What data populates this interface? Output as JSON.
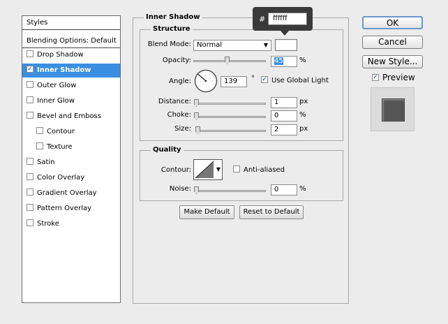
{
  "styles_panel": {
    "header": "Styles",
    "blending_options": "Blending Options: Default",
    "items": [
      {
        "label": "Drop Shadow",
        "checked": false,
        "indent": false
      },
      {
        "label": "Inner Shadow",
        "checked": true,
        "indent": false,
        "selected": true
      },
      {
        "label": "Outer Glow",
        "checked": false,
        "indent": false
      },
      {
        "label": "Inner Glow",
        "checked": false,
        "indent": false
      },
      {
        "label": "Bevel and Emboss",
        "checked": false,
        "indent": false
      },
      {
        "label": "Contour",
        "checked": false,
        "indent": true
      },
      {
        "label": "Texture",
        "checked": false,
        "indent": true
      },
      {
        "label": "Satin",
        "checked": false,
        "indent": false
      },
      {
        "label": "Color Overlay",
        "checked": false,
        "indent": false
      },
      {
        "label": "Gradient Overlay",
        "checked": false,
        "indent": false
      },
      {
        "label": "Pattern Overlay",
        "checked": false,
        "indent": false
      },
      {
        "label": "Stroke",
        "checked": false,
        "indent": false
      }
    ]
  },
  "inner_shadow": {
    "title": "Inner Shadow",
    "structure": {
      "title": "Structure",
      "blend_mode_label": "Blend Mode:",
      "blend_mode_value": "Normal",
      "opacity_label": "Opacity:",
      "opacity_value": "45",
      "opacity_unit": "%",
      "angle_label": "Angle:",
      "angle_value": "139",
      "angle_unit": "°",
      "use_global_light_label": "Use Global Light",
      "distance_label": "Distance:",
      "distance_value": "1",
      "distance_unit": "px",
      "choke_label": "Choke:",
      "choke_value": "0",
      "choke_unit": "%",
      "size_label": "Size:",
      "size_value": "2",
      "size_unit": "px"
    },
    "quality": {
      "title": "Quality",
      "contour_label": "Contour:",
      "anti_aliased_label": "Anti-aliased",
      "noise_label": "Noise:",
      "noise_value": "0",
      "noise_unit": "%"
    },
    "make_default_label": "Make Default",
    "reset_default_label": "Reset to Default"
  },
  "color_tooltip": {
    "hash": "#",
    "value": "ffffff"
  },
  "right_buttons": {
    "ok": "OK",
    "cancel": "Cancel",
    "new_style": "New Style...",
    "preview_label": "Preview"
  },
  "colors": {
    "selection": "#3b8fe0",
    "shadow_color": "#ffffff",
    "preview_swatch": "#555555"
  }
}
